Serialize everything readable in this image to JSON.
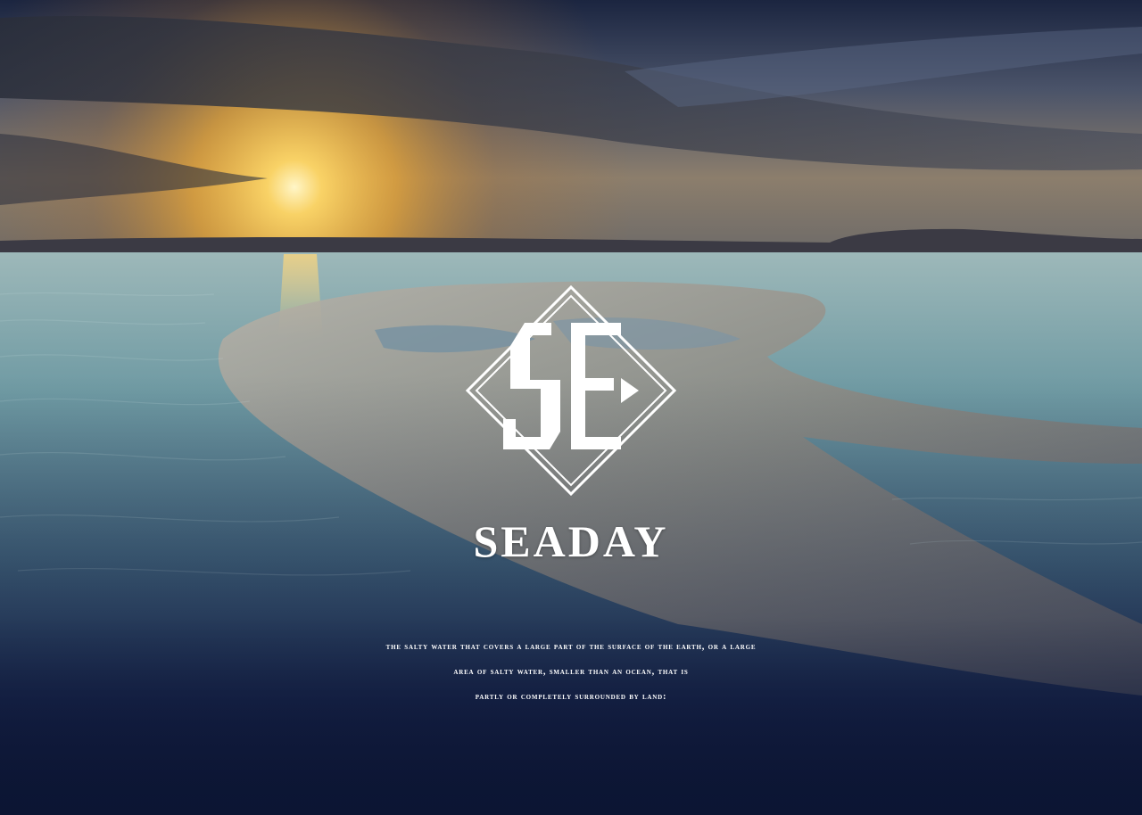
{
  "brand": {
    "name": "SEADAY",
    "logo_monogram": "SE",
    "logo_icon": "diamond-monogram-icon"
  },
  "tagline": {
    "lines": [
      "THE SALTY WATER THAT COVERS A LARGE PART OF THE SURFACE OF THE EARTH, OR A LARGE",
      "AREA OF SALTY WATER, SMALLER THAN AN OCEAN, THAT IS",
      "PARTLY OR COMPLETELY SURROUNDED BY LAND:"
    ]
  },
  "theme": {
    "text_color": "#ffffff",
    "sky_top": "#1e2a4a",
    "sun_glow": "#ffc84a",
    "water": "#7fa9b0",
    "deep_navy": "#0c1533"
  }
}
